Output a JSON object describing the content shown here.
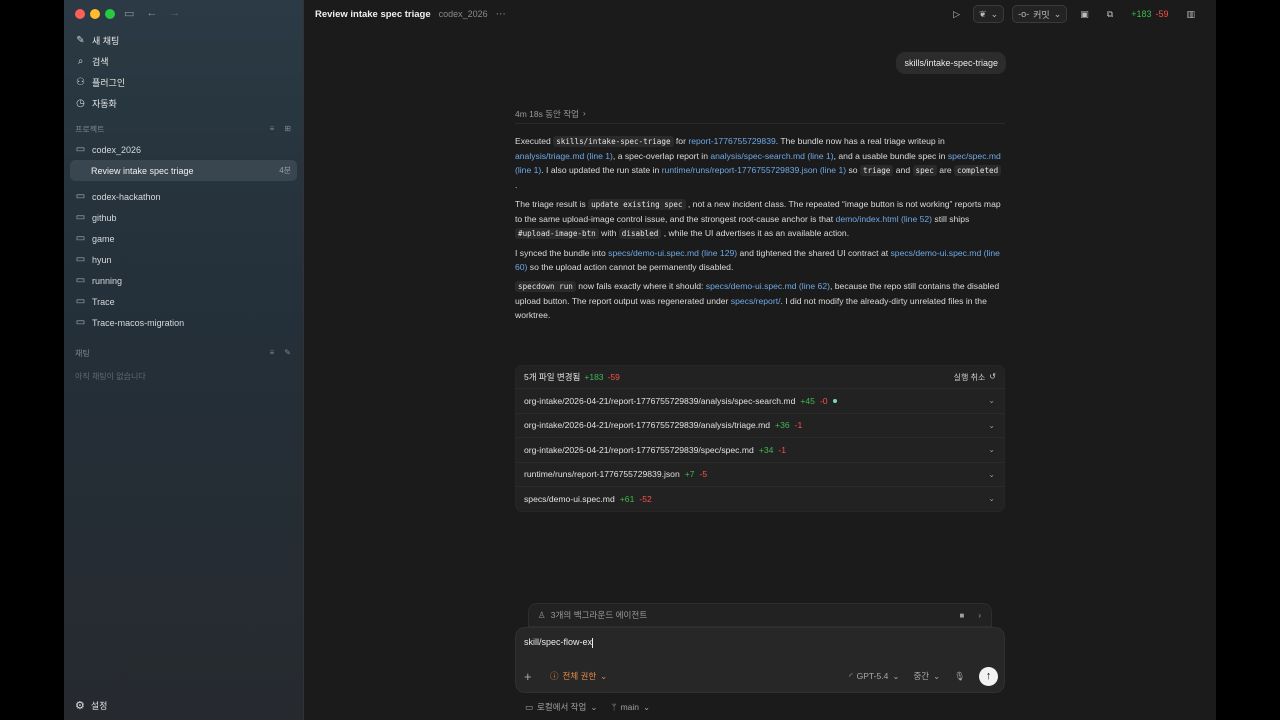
{
  "sidebar": {
    "nav": [
      {
        "icon": "compose-icon",
        "label": "새 채팅",
        "glyph": "✎"
      },
      {
        "icon": "search-icon",
        "label": "검색",
        "glyph": "⌕"
      },
      {
        "icon": "plugin-icon",
        "label": "플러그인",
        "glyph": "⚇"
      },
      {
        "icon": "clock-icon",
        "label": "자동화",
        "glyph": "◷"
      }
    ],
    "projects_heading": "프로젝트",
    "projects": [
      {
        "label": "codex_2026"
      },
      {
        "label": "Review intake spec triage",
        "time": "4분"
      },
      {
        "label": "codex-hackathon"
      },
      {
        "label": "github"
      },
      {
        "label": "game"
      },
      {
        "label": "hyun"
      },
      {
        "label": "running"
      },
      {
        "label": "Trace"
      },
      {
        "label": "Trace-macos-migration"
      }
    ],
    "chats_heading": "채팅",
    "chats_empty": "아직 채팅이 없습니다",
    "settings_label": "설정"
  },
  "header": {
    "title": "Review intake spec triage",
    "project": "codex_2026",
    "commit_label": "커밋",
    "diff_add": "+183",
    "diff_del": "-59"
  },
  "thread": {
    "user_message": "skills/intake-spec-triage",
    "work_time": "4m 18s 동안 작업",
    "paragraphs": {
      "p1": {
        "t1": "Executed ",
        "c1": "skills/intake-spec-triage",
        "t2": " for ",
        "l1": "report-1776755729839",
        "t3": ". The bundle now has a real triage writeup in ",
        "l2": "analysis/triage.md (line 1)",
        "t4": ", a spec-overlap report in ",
        "l3": "analysis/spec-search.md (line 1)",
        "t5": ", and a usable bundle spec in ",
        "l4": "spec/spec.md (line 1)",
        "t6": ". I also updated the run state in ",
        "l5": "runtime/runs/report-1776755729839.json (line 1)",
        "t7": " so ",
        "c2": "triage",
        "t8": " and ",
        "c3": "spec",
        "t9": " are ",
        "c4": "completed",
        "t10": " ."
      },
      "p2": {
        "t1": "The triage result is ",
        "c1": "update existing spec",
        "t2": " , not a new incident class. The repeated “image button is not working” reports map to the same upload-image control issue, and the strongest root-cause anchor is that ",
        "l1": "demo/index.html (line 52)",
        "t3": " still ships ",
        "c2": "#upload-image-btn",
        "t4": " with ",
        "c3": "disabled",
        "t5": " , while the UI advertises it as an available action."
      },
      "p3": {
        "t1": "I synced the bundle into ",
        "l1": "specs/demo-ui.spec.md (line 129)",
        "t2": " and tightened the shared UI contract at ",
        "l2": "specs/demo-ui.spec.md (line 60)",
        "t3": " so the upload action cannot be permanently disabled."
      },
      "p4": {
        "c1": "specdown run",
        "t1": " now fails exactly where it should: ",
        "l1": "specs/demo-ui.spec.md (line 62)",
        "t2": ", because the repo still contains the disabled upload button. The report output was regenerated under ",
        "l2": "specs/report/",
        "t3": ". I did not modify the already-dirty unrelated files in the worktree."
      }
    },
    "diff_summary": {
      "label": "5개 파일 변경됨",
      "add": "+183",
      "del": "-59",
      "undo_label": "실행 취소"
    },
    "files": [
      {
        "path": "org-intake/2026-04-21/report-1776755729839/analysis/spec-search.md",
        "add": "+45",
        "del": "-0"
      },
      {
        "path": "org-intake/2026-04-21/report-1776755729839/analysis/triage.md",
        "add": "+36",
        "del": "-1"
      },
      {
        "path": "org-intake/2026-04-21/report-1776755729839/spec/spec.md",
        "add": "+34",
        "del": "-1"
      },
      {
        "path": "runtime/runs/report-1776755729839.json",
        "add": "+7",
        "del": "-5"
      },
      {
        "path": "specs/demo-ui.spec.md",
        "add": "+61",
        "del": "-52"
      }
    ]
  },
  "composer": {
    "bg_agents": "3개의 백그라운드 에이전트",
    "input_value": "skill/spec-flow-ex",
    "permission": "전체 권한",
    "model": "GPT-5.4",
    "effort": "중간"
  },
  "footer": {
    "location": "로컬에서 작업",
    "branch": "main"
  },
  "colors": {
    "add": "#3fb950",
    "del": "#f85149",
    "link": "#6fa8e6",
    "permission": "#e58a4a"
  }
}
